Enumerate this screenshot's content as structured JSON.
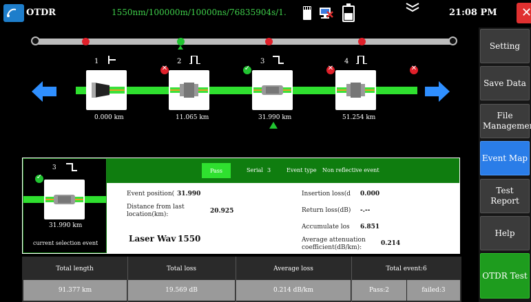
{
  "topbar": {
    "title": "OTDR",
    "params": "1550nm/100000m/10000ns/76835904s/1.",
    "time": "21:08 PM",
    "icons": [
      "app-icon",
      "sd-card-icon",
      "network-icon",
      "battery-icon",
      "chevron-icon",
      "close-icon"
    ]
  },
  "sidebar": {
    "items": [
      {
        "label": "Setting"
      },
      {
        "label": "Save Data"
      },
      {
        "label": "File Management"
      },
      {
        "label": "Event Map"
      },
      {
        "label": "Test Report"
      },
      {
        "label": "Help"
      },
      {
        "label": "OTDR Test"
      }
    ],
    "active": "Event Map",
    "colors": {
      "active": "#2a7de8",
      "test": "#1e9c1e",
      "default": "#3b3b3b"
    }
  },
  "events": [
    {
      "index": "1",
      "distance": "0.000 km",
      "status": "none",
      "type": "launch"
    },
    {
      "index": "2",
      "distance": "11.065 km",
      "status": "fail",
      "type": "reflective"
    },
    {
      "index": "3",
      "distance": "31.990 km",
      "status": "pass",
      "type": "non-reflective"
    },
    {
      "index": "4",
      "distance": "51.254 km",
      "status": "fail",
      "type": "reflective"
    }
  ],
  "selected_event": "3",
  "detail": {
    "index": "3",
    "distance": "31.990 km",
    "caption": "current selection event",
    "pass": "Pass",
    "serial_label": "Serial",
    "serial": "3",
    "event_type_label": "Event type",
    "event_type": "Non reflective event",
    "event_position_label": "Event position(",
    "event_position": "31.990",
    "distance_from_last_label": "Distance from last location(km):",
    "distance_from_last": "20.925",
    "laser_label": "Laser Wav",
    "laser_value": "1550",
    "insertion_loss_label": "Insertion loss(d",
    "insertion_loss": "0.000",
    "return_loss_label": "Return loss(dB)",
    "return_loss": "-.--",
    "accumulate_loss_label": "Accumulate los",
    "accumulate_loss": "6.851",
    "avg_atten_label": "Average attenuation coefficient(dB/km):",
    "avg_atten": "0.214"
  },
  "summary": {
    "total_length_label": "Total length",
    "total_length": "91.377 km",
    "total_loss_label": "Total loss",
    "total_loss": "19.569 dB",
    "average_loss_label": "Average loss",
    "average_loss": "0.214 dB/km",
    "total_event_label": "Total event:6",
    "pass": "Pass:2",
    "failed": "failed:3"
  }
}
